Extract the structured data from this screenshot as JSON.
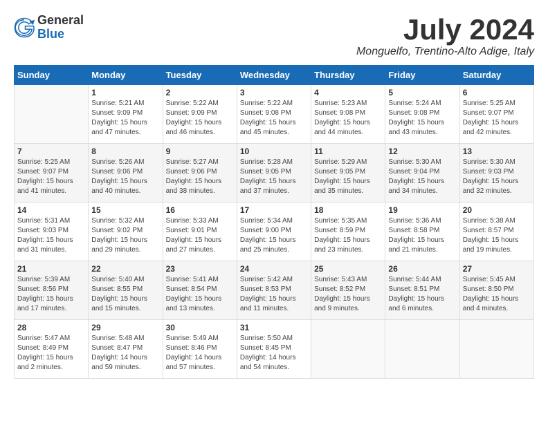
{
  "header": {
    "logo_general": "General",
    "logo_blue": "Blue",
    "month": "July 2024",
    "location": "Monguelfo, Trentino-Alto Adige, Italy"
  },
  "days_of_week": [
    "Sunday",
    "Monday",
    "Tuesday",
    "Wednesday",
    "Thursday",
    "Friday",
    "Saturday"
  ],
  "weeks": [
    [
      {
        "day": "",
        "sunrise": "",
        "sunset": "",
        "daylight": ""
      },
      {
        "day": "1",
        "sunrise": "Sunrise: 5:21 AM",
        "sunset": "Sunset: 9:09 PM",
        "daylight": "Daylight: 15 hours and 47 minutes."
      },
      {
        "day": "2",
        "sunrise": "Sunrise: 5:22 AM",
        "sunset": "Sunset: 9:09 PM",
        "daylight": "Daylight: 15 hours and 46 minutes."
      },
      {
        "day": "3",
        "sunrise": "Sunrise: 5:22 AM",
        "sunset": "Sunset: 9:08 PM",
        "daylight": "Daylight: 15 hours and 45 minutes."
      },
      {
        "day": "4",
        "sunrise": "Sunrise: 5:23 AM",
        "sunset": "Sunset: 9:08 PM",
        "daylight": "Daylight: 15 hours and 44 minutes."
      },
      {
        "day": "5",
        "sunrise": "Sunrise: 5:24 AM",
        "sunset": "Sunset: 9:08 PM",
        "daylight": "Daylight: 15 hours and 43 minutes."
      },
      {
        "day": "6",
        "sunrise": "Sunrise: 5:25 AM",
        "sunset": "Sunset: 9:07 PM",
        "daylight": "Daylight: 15 hours and 42 minutes."
      }
    ],
    [
      {
        "day": "7",
        "sunrise": "Sunrise: 5:25 AM",
        "sunset": "Sunset: 9:07 PM",
        "daylight": "Daylight: 15 hours and 41 minutes."
      },
      {
        "day": "8",
        "sunrise": "Sunrise: 5:26 AM",
        "sunset": "Sunset: 9:06 PM",
        "daylight": "Daylight: 15 hours and 40 minutes."
      },
      {
        "day": "9",
        "sunrise": "Sunrise: 5:27 AM",
        "sunset": "Sunset: 9:06 PM",
        "daylight": "Daylight: 15 hours and 38 minutes."
      },
      {
        "day": "10",
        "sunrise": "Sunrise: 5:28 AM",
        "sunset": "Sunset: 9:05 PM",
        "daylight": "Daylight: 15 hours and 37 minutes."
      },
      {
        "day": "11",
        "sunrise": "Sunrise: 5:29 AM",
        "sunset": "Sunset: 9:05 PM",
        "daylight": "Daylight: 15 hours and 35 minutes."
      },
      {
        "day": "12",
        "sunrise": "Sunrise: 5:30 AM",
        "sunset": "Sunset: 9:04 PM",
        "daylight": "Daylight: 15 hours and 34 minutes."
      },
      {
        "day": "13",
        "sunrise": "Sunrise: 5:30 AM",
        "sunset": "Sunset: 9:03 PM",
        "daylight": "Daylight: 15 hours and 32 minutes."
      }
    ],
    [
      {
        "day": "14",
        "sunrise": "Sunrise: 5:31 AM",
        "sunset": "Sunset: 9:03 PM",
        "daylight": "Daylight: 15 hours and 31 minutes."
      },
      {
        "day": "15",
        "sunrise": "Sunrise: 5:32 AM",
        "sunset": "Sunset: 9:02 PM",
        "daylight": "Daylight: 15 hours and 29 minutes."
      },
      {
        "day": "16",
        "sunrise": "Sunrise: 5:33 AM",
        "sunset": "Sunset: 9:01 PM",
        "daylight": "Daylight: 15 hours and 27 minutes."
      },
      {
        "day": "17",
        "sunrise": "Sunrise: 5:34 AM",
        "sunset": "Sunset: 9:00 PM",
        "daylight": "Daylight: 15 hours and 25 minutes."
      },
      {
        "day": "18",
        "sunrise": "Sunrise: 5:35 AM",
        "sunset": "Sunset: 8:59 PM",
        "daylight": "Daylight: 15 hours and 23 minutes."
      },
      {
        "day": "19",
        "sunrise": "Sunrise: 5:36 AM",
        "sunset": "Sunset: 8:58 PM",
        "daylight": "Daylight: 15 hours and 21 minutes."
      },
      {
        "day": "20",
        "sunrise": "Sunrise: 5:38 AM",
        "sunset": "Sunset: 8:57 PM",
        "daylight": "Daylight: 15 hours and 19 minutes."
      }
    ],
    [
      {
        "day": "21",
        "sunrise": "Sunrise: 5:39 AM",
        "sunset": "Sunset: 8:56 PM",
        "daylight": "Daylight: 15 hours and 17 minutes."
      },
      {
        "day": "22",
        "sunrise": "Sunrise: 5:40 AM",
        "sunset": "Sunset: 8:55 PM",
        "daylight": "Daylight: 15 hours and 15 minutes."
      },
      {
        "day": "23",
        "sunrise": "Sunrise: 5:41 AM",
        "sunset": "Sunset: 8:54 PM",
        "daylight": "Daylight: 15 hours and 13 minutes."
      },
      {
        "day": "24",
        "sunrise": "Sunrise: 5:42 AM",
        "sunset": "Sunset: 8:53 PM",
        "daylight": "Daylight: 15 hours and 11 minutes."
      },
      {
        "day": "25",
        "sunrise": "Sunrise: 5:43 AM",
        "sunset": "Sunset: 8:52 PM",
        "daylight": "Daylight: 15 hours and 9 minutes."
      },
      {
        "day": "26",
        "sunrise": "Sunrise: 5:44 AM",
        "sunset": "Sunset: 8:51 PM",
        "daylight": "Daylight: 15 hours and 6 minutes."
      },
      {
        "day": "27",
        "sunrise": "Sunrise: 5:45 AM",
        "sunset": "Sunset: 8:50 PM",
        "daylight": "Daylight: 15 hours and 4 minutes."
      }
    ],
    [
      {
        "day": "28",
        "sunrise": "Sunrise: 5:47 AM",
        "sunset": "Sunset: 8:49 PM",
        "daylight": "Daylight: 15 hours and 2 minutes."
      },
      {
        "day": "29",
        "sunrise": "Sunrise: 5:48 AM",
        "sunset": "Sunset: 8:47 PM",
        "daylight": "Daylight: 14 hours and 59 minutes."
      },
      {
        "day": "30",
        "sunrise": "Sunrise: 5:49 AM",
        "sunset": "Sunset: 8:46 PM",
        "daylight": "Daylight: 14 hours and 57 minutes."
      },
      {
        "day": "31",
        "sunrise": "Sunrise: 5:50 AM",
        "sunset": "Sunset: 8:45 PM",
        "daylight": "Daylight: 14 hours and 54 minutes."
      },
      {
        "day": "",
        "sunrise": "",
        "sunset": "",
        "daylight": ""
      },
      {
        "day": "",
        "sunrise": "",
        "sunset": "",
        "daylight": ""
      },
      {
        "day": "",
        "sunrise": "",
        "sunset": "",
        "daylight": ""
      }
    ]
  ]
}
